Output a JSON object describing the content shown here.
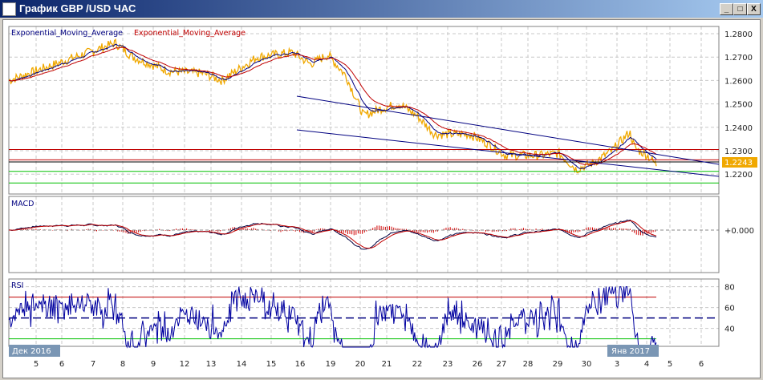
{
  "window": {
    "title": "График GBP /USD  ЧАС",
    "minimize": "_",
    "maximize": "□",
    "close": "X"
  },
  "legend": {
    "ema1": "Exponential_Moving_Average",
    "ema2": "Exponential_Moving_Average",
    "macd": "MACD",
    "rsi": "RSI"
  },
  "colors": {
    "price": "#f0a800",
    "ema_fast": "#000080",
    "ema_slow": "#c00000",
    "resistance": "#c00000",
    "support": "#00c000",
    "channel": "#000080"
  },
  "chart_data": [
    {
      "type": "line",
      "title": "GBP/USD H1",
      "yticks": [
        "1.2800",
        "1.2700",
        "1.2600",
        "1.2500",
        "1.2400",
        "1.2300",
        "1.2200"
      ],
      "ylim": [
        1.217,
        1.2835
      ],
      "last_price": "1.2243",
      "price_keypoints": [
        [
          0,
          1.26
        ],
        [
          3,
          1.268
        ],
        [
          6,
          1.276
        ],
        [
          7,
          1.27
        ],
        [
          9,
          1.264
        ],
        [
          11,
          1.263
        ],
        [
          12,
          1.26
        ],
        [
          14,
          1.27
        ],
        [
          16,
          1.272
        ],
        [
          17,
          1.267
        ],
        [
          18,
          1.271
        ],
        [
          19,
          1.262
        ],
        [
          20,
          1.245
        ],
        [
          21,
          1.248
        ],
        [
          22,
          1.25
        ],
        [
          23,
          1.245
        ],
        [
          24,
          1.237
        ],
        [
          26,
          1.237
        ],
        [
          27,
          1.233
        ],
        [
          28,
          1.228
        ],
        [
          30,
          1.228
        ],
        [
          31,
          1.229
        ],
        [
          32,
          1.222
        ],
        [
          33,
          1.225
        ],
        [
          34,
          1.23
        ],
        [
          35,
          1.238
        ],
        [
          35.3,
          1.231
        ],
        [
          36,
          1.228
        ],
        [
          36.5,
          1.224
        ]
      ],
      "horizontal_levels": {
        "resistance": [
          1.2305,
          1.2261
        ],
        "pivot": 1.2252,
        "support": [
          1.2212,
          1.2162
        ]
      }
    },
    {
      "type": "line",
      "title": "MACD",
      "yticks": [
        "+0.000"
      ]
    },
    {
      "type": "line",
      "title": "RSI",
      "yticks": [
        "80",
        "60",
        "40"
      ],
      "levels": [
        70,
        50,
        30
      ]
    }
  ],
  "xaxis": {
    "labels": [
      "5",
      "6",
      "7",
      "8",
      "9",
      "12",
      "13",
      "14",
      "15",
      "16",
      "19",
      "20",
      "21",
      "22",
      "23",
      "26",
      "27",
      "28",
      "29",
      "30",
      "3",
      "4",
      "5",
      "6"
    ],
    "month_left": "Дек 2016",
    "month_right": "Янв 2017"
  }
}
